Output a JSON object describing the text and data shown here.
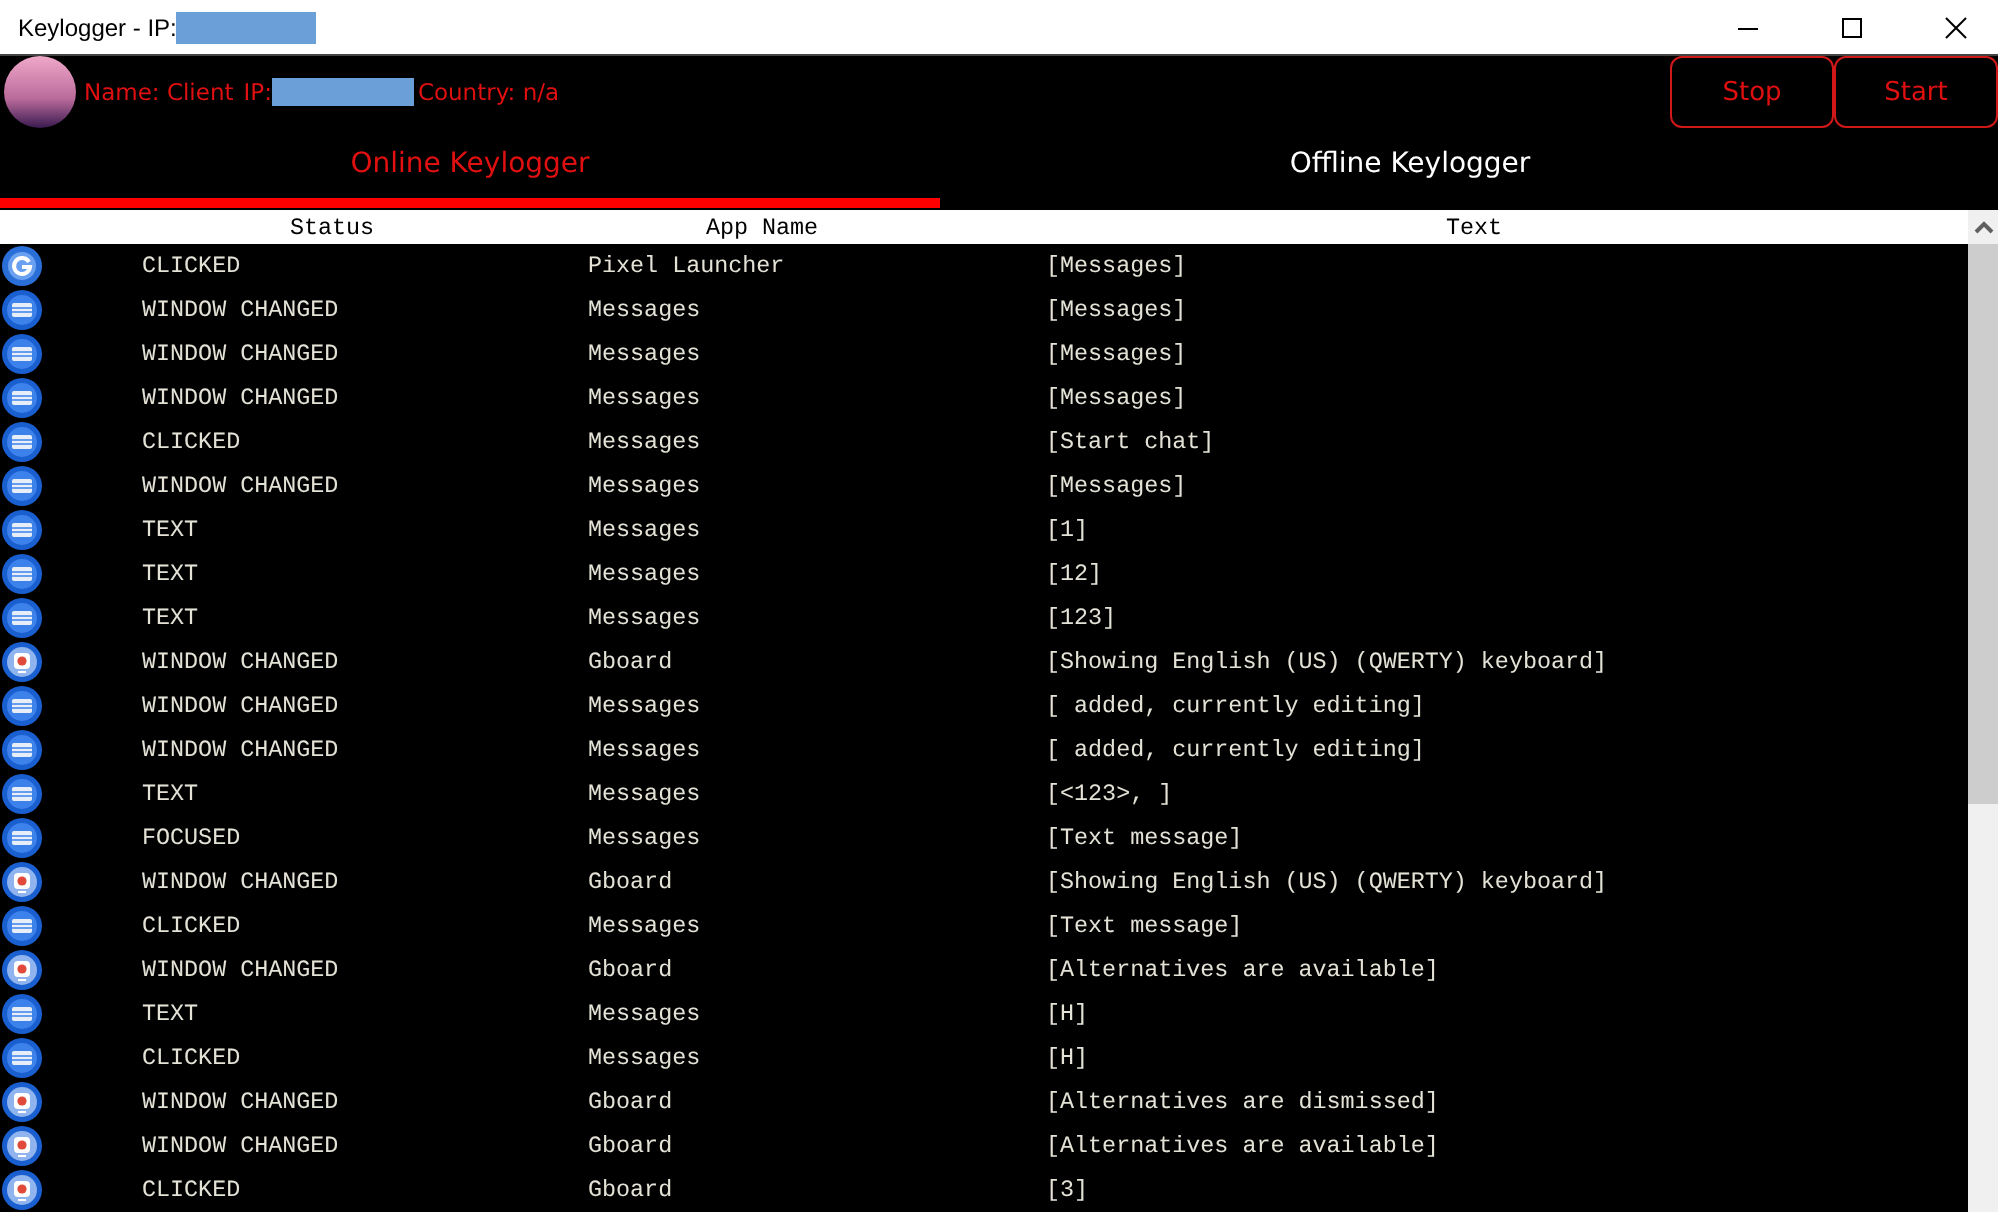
{
  "window": {
    "title": "Keylogger - IP:"
  },
  "client": {
    "name_label": "Name: Client",
    "ip_label": "IP:",
    "country_label": "Country: n/a"
  },
  "buttons": [
    "Stop",
    "Start"
  ],
  "tabs": [
    {
      "label": "Online Keylogger",
      "selected": true
    },
    {
      "label": "Offline Keylogger",
      "selected": false
    }
  ],
  "table": {
    "columns": [
      "Status",
      "App Name",
      "Text"
    ],
    "rows": [
      {
        "kind": "launcher",
        "status": "CLICKED",
        "app": "Pixel Launcher",
        "text": "[Messages]"
      },
      {
        "kind": "messages",
        "status": "WINDOW CHANGED",
        "app": "Messages",
        "text": "[Messages]"
      },
      {
        "kind": "messages",
        "status": "WINDOW CHANGED",
        "app": "Messages",
        "text": "[Messages]"
      },
      {
        "kind": "messages",
        "status": "WINDOW CHANGED",
        "app": "Messages",
        "text": "[Messages]"
      },
      {
        "kind": "messages",
        "status": "CLICKED",
        "app": "Messages",
        "text": "[Start chat]"
      },
      {
        "kind": "messages",
        "status": "WINDOW CHANGED",
        "app": "Messages",
        "text": "[Messages]"
      },
      {
        "kind": "messages",
        "status": "TEXT",
        "app": "Messages",
        "text": "[1]"
      },
      {
        "kind": "messages",
        "status": "TEXT",
        "app": "Messages",
        "text": "[12]"
      },
      {
        "kind": "messages",
        "status": "TEXT",
        "app": "Messages",
        "text": "[123]"
      },
      {
        "kind": "gboard",
        "status": "WINDOW CHANGED",
        "app": "Gboard",
        "text": "[Showing English (US) (QWERTY) keyboard]"
      },
      {
        "kind": "messages",
        "status": "WINDOW CHANGED",
        "app": "Messages",
        "text": "[ added, currently editing]"
      },
      {
        "kind": "messages",
        "status": "WINDOW CHANGED",
        "app": "Messages",
        "text": "[ added, currently editing]"
      },
      {
        "kind": "messages",
        "status": "TEXT",
        "app": "Messages",
        "text": "[<123>, ]"
      },
      {
        "kind": "messages",
        "status": "FOCUSED",
        "app": "Messages",
        "text": "[Text message]"
      },
      {
        "kind": "gboard",
        "status": "WINDOW CHANGED",
        "app": "Gboard",
        "text": "[Showing English (US) (QWERTY) keyboard]"
      },
      {
        "kind": "messages",
        "status": "CLICKED",
        "app": "Messages",
        "text": "[Text message]"
      },
      {
        "kind": "gboard",
        "status": "WINDOW CHANGED",
        "app": "Gboard",
        "text": "[Alternatives are available]"
      },
      {
        "kind": "messages",
        "status": "TEXT",
        "app": "Messages",
        "text": "[H]"
      },
      {
        "kind": "messages",
        "status": "CLICKED",
        "app": "Messages",
        "text": "[H]"
      },
      {
        "kind": "gboard",
        "status": "WINDOW CHANGED",
        "app": "Gboard",
        "text": "[Alternatives are dismissed]"
      },
      {
        "kind": "gboard",
        "status": "WINDOW CHANGED",
        "app": "Gboard",
        "text": "[Alternatives are available]"
      },
      {
        "kind": "gboard",
        "status": "CLICKED",
        "app": "Gboard",
        "text": "[3]"
      }
    ]
  }
}
